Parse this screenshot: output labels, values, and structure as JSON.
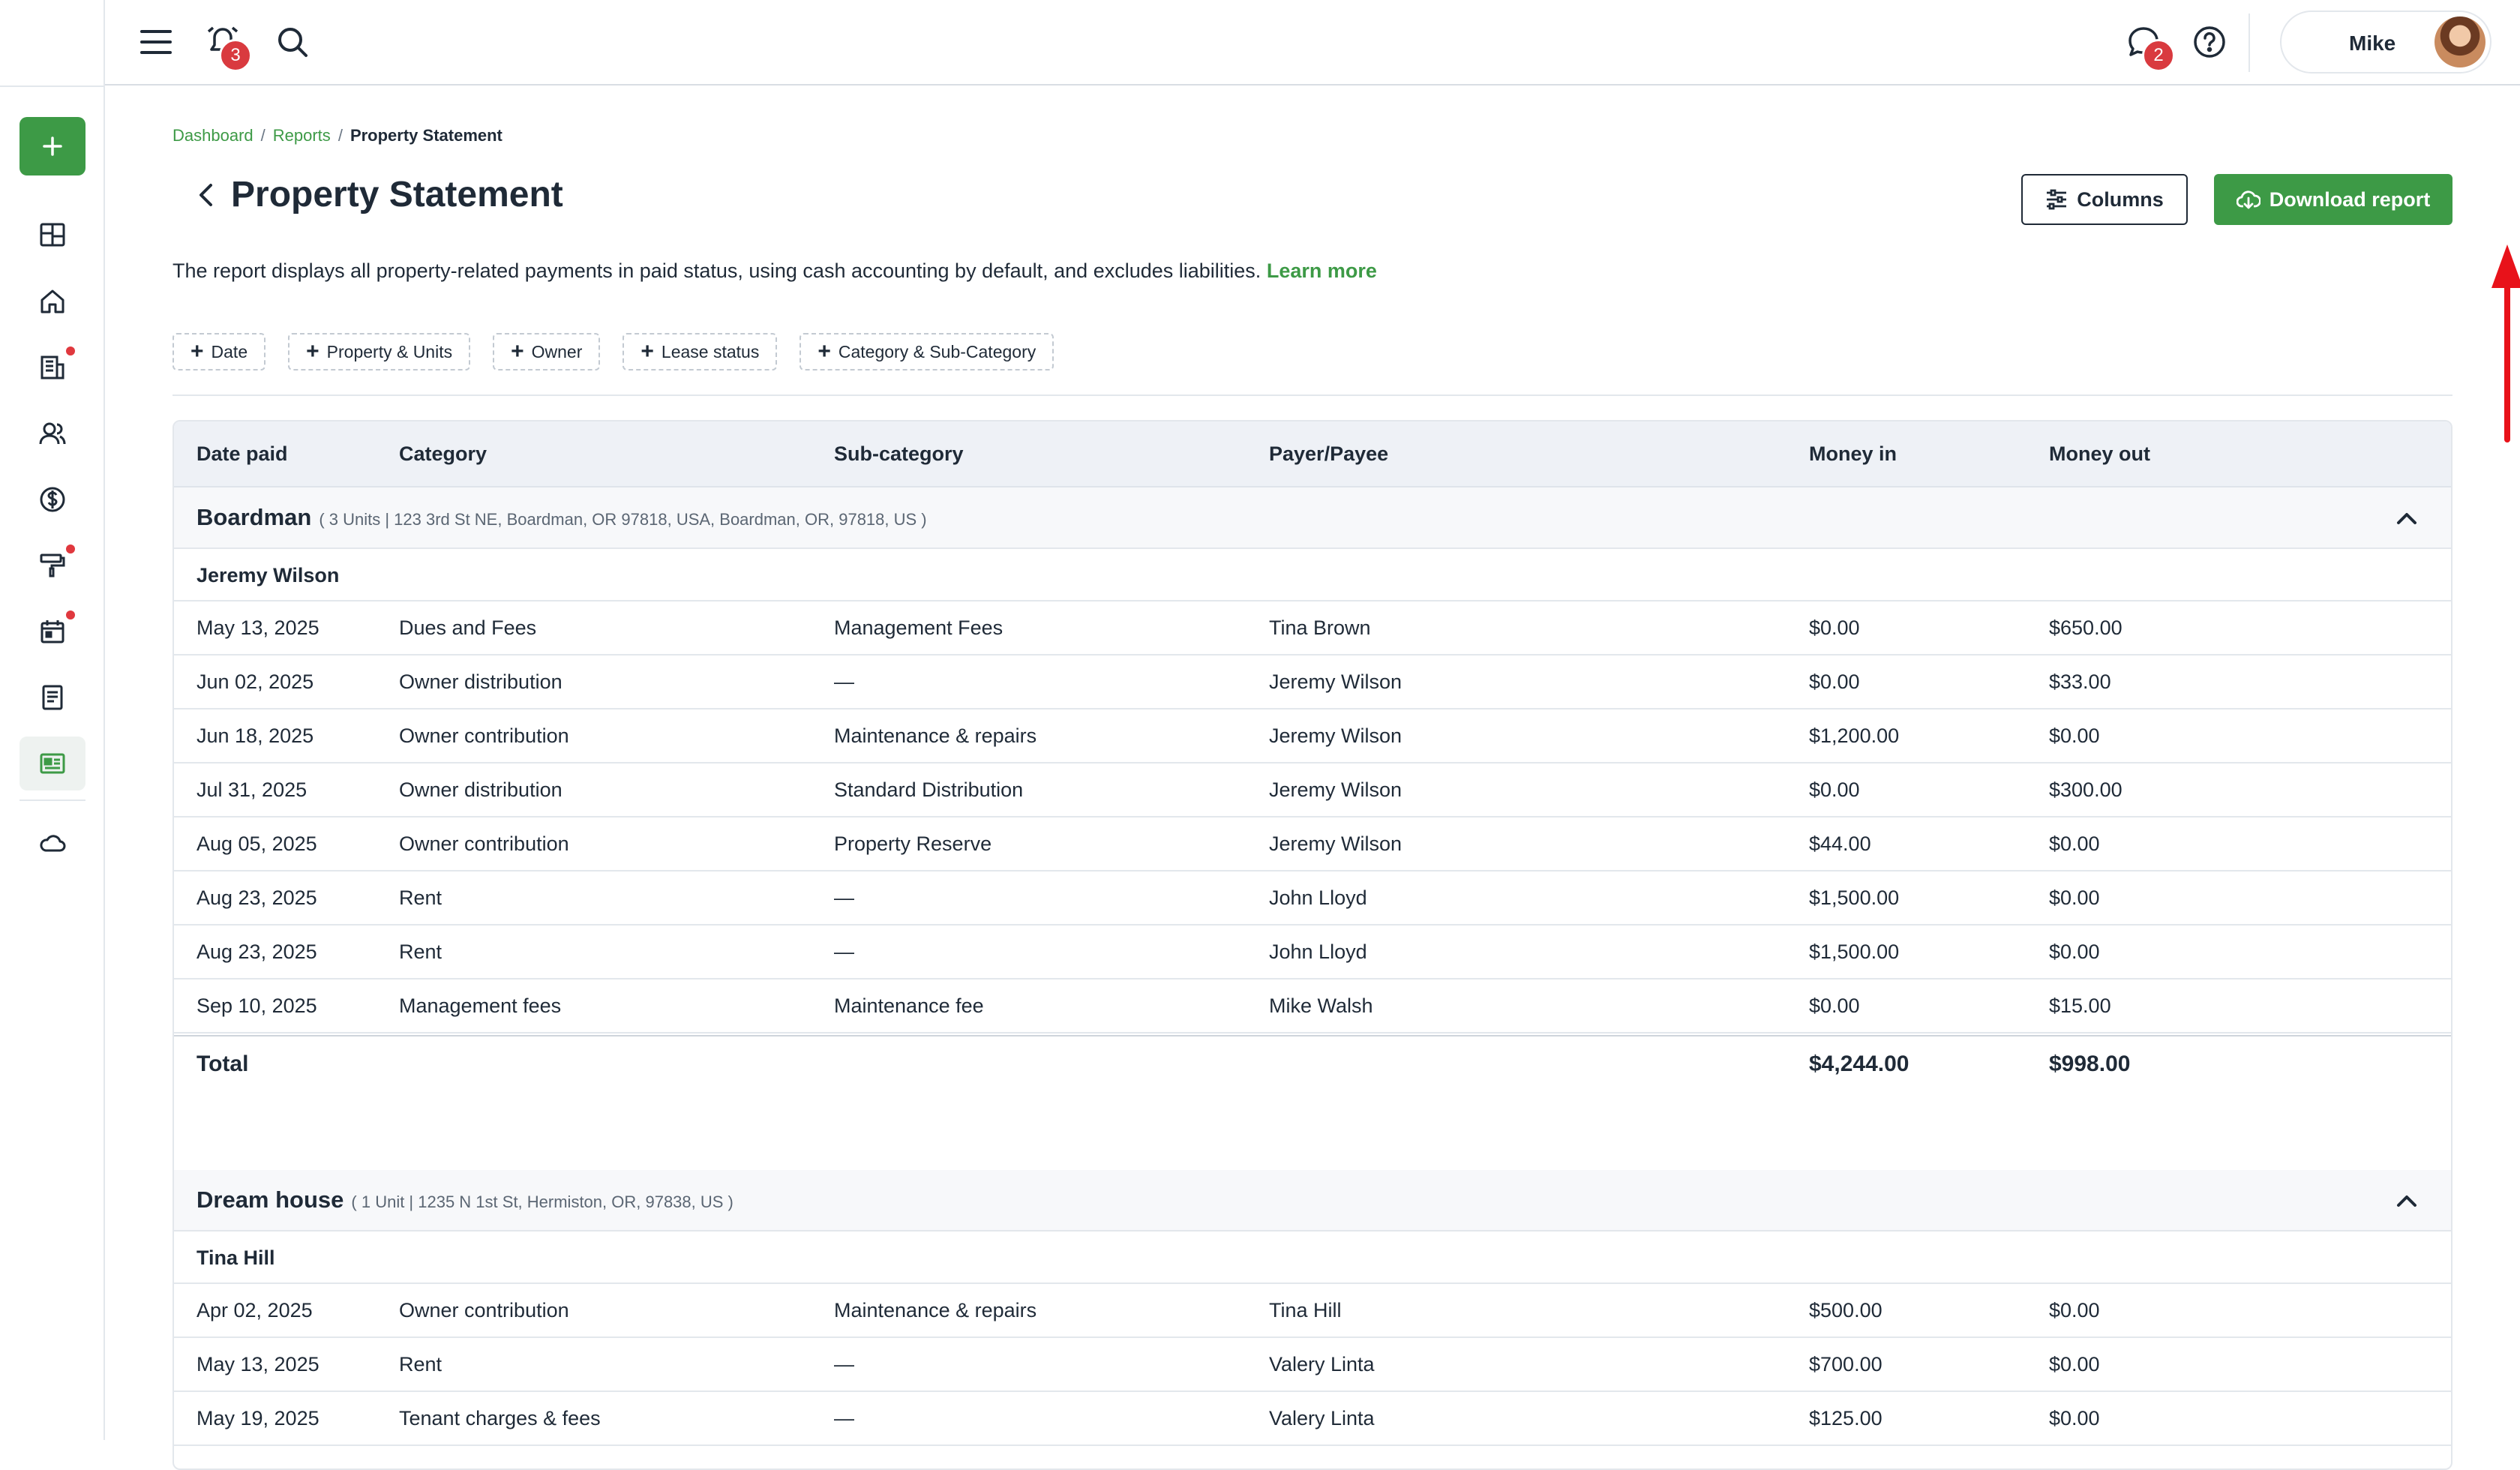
{
  "topbar": {
    "notifications_count": "3",
    "messages_count": "2",
    "user_name": "Mike"
  },
  "breadcrumb": {
    "items": [
      "Dashboard",
      "Reports"
    ],
    "current": "Property Statement",
    "separator": "/"
  },
  "page": {
    "title": "Property Statement",
    "columns_label": "Columns",
    "download_label": "Download report",
    "description": "The report displays all property-related payments in paid status, using cash accounting by default, and excludes liabilities.",
    "learn_more": "Learn more"
  },
  "filters": [
    "Date",
    "Property & Units",
    "Owner",
    "Lease status",
    "Category & Sub-Category"
  ],
  "table": {
    "headers": {
      "date": "Date paid",
      "category": "Category",
      "sub": "Sub-category",
      "payer": "Payer/Payee",
      "money_in": "Money in",
      "money_out": "Money out"
    },
    "groups": [
      {
        "name": "Boardman",
        "meta": "( 3 Units | 123 3rd St NE, Boardman, OR 97818, USA, Boardman, OR, 97818, US )",
        "owner": "Jeremy Wilson",
        "rows": [
          {
            "date": "May 13, 2025",
            "category": "Dues and Fees",
            "sub": "Management Fees",
            "payer": "Tina Brown",
            "in": "$0.00",
            "out": "$650.00"
          },
          {
            "date": "Jun 02, 2025",
            "category": "Owner distribution",
            "sub": "—",
            "payer": "Jeremy Wilson",
            "in": "$0.00",
            "out": "$33.00"
          },
          {
            "date": "Jun 18, 2025",
            "category": "Owner contribution",
            "sub": "Maintenance & repairs",
            "payer": "Jeremy Wilson",
            "in": "$1,200.00",
            "out": "$0.00"
          },
          {
            "date": "Jul 31, 2025",
            "category": "Owner distribution",
            "sub": "Standard Distribution",
            "payer": "Jeremy Wilson",
            "in": "$0.00",
            "out": "$300.00"
          },
          {
            "date": "Aug 05, 2025",
            "category": "Owner contribution",
            "sub": "Property Reserve",
            "payer": "Jeremy Wilson",
            "in": "$44.00",
            "out": "$0.00"
          },
          {
            "date": "Aug 23, 2025",
            "category": "Rent",
            "sub": "—",
            "payer": "John Lloyd",
            "in": "$1,500.00",
            "out": "$0.00"
          },
          {
            "date": "Aug 23, 2025",
            "category": "Rent",
            "sub": "—",
            "payer": "John Lloyd",
            "in": "$1,500.00",
            "out": "$0.00"
          },
          {
            "date": "Sep 10, 2025",
            "category": "Management fees",
            "sub": "Maintenance fee",
            "payer": "Mike Walsh",
            "in": "$0.00",
            "out": "$15.00"
          }
        ],
        "total_label": "Total",
        "total_in": "$4,244.00",
        "total_out": "$998.00"
      },
      {
        "name": "Dream house",
        "meta": "( 1 Unit | 1235 N 1st St, Hermiston, OR, 97838, US )",
        "owner": "Tina Hill",
        "rows": [
          {
            "date": "Apr 02, 2025",
            "category": "Owner contribution",
            "sub": "Maintenance & repairs",
            "payer": "Tina Hill",
            "in": "$500.00",
            "out": "$0.00"
          },
          {
            "date": "May 13, 2025",
            "category": "Rent",
            "sub": "—",
            "payer": "Valery Linta",
            "in": "$700.00",
            "out": "$0.00"
          },
          {
            "date": "May 19, 2025",
            "category": "Tenant charges & fees",
            "sub": "—",
            "payer": "Valery Linta",
            "in": "$125.00",
            "out": "$0.00"
          }
        ]
      }
    ]
  },
  "colors": {
    "brand_green": "#3d9a46",
    "badge_red": "#d93a3f",
    "annotation_red": "#e8121a"
  }
}
